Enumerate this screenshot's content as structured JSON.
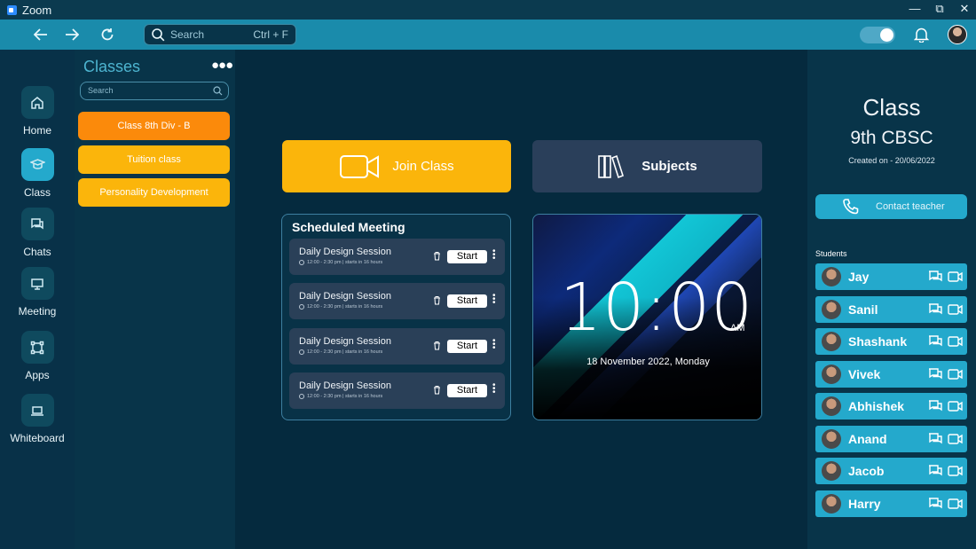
{
  "window": {
    "title": "Zoom"
  },
  "toolbar": {
    "search_placeholder": "Search",
    "search_shortcut": "Ctrl + F"
  },
  "rail": {
    "items": [
      {
        "label": "Home",
        "icon": "home-icon",
        "active": false
      },
      {
        "label": "Class",
        "icon": "graduation-cap-icon",
        "active": true
      },
      {
        "label": "Chats",
        "icon": "chat-icon",
        "active": false
      },
      {
        "label": "Meeting",
        "icon": "presentation-icon",
        "active": false
      },
      {
        "label": "Apps",
        "icon": "apps-icon",
        "active": false
      },
      {
        "label": "Whiteboard",
        "icon": "laptop-icon",
        "active": false
      }
    ]
  },
  "classes": {
    "title": "Classes",
    "search_placeholder": "Search",
    "items": [
      {
        "label": "Class 8th Div - B",
        "color": "#fb8a0b"
      },
      {
        "label": "Tuition class",
        "color": "#fbb50b"
      },
      {
        "label": "Personality Development",
        "color": "#fbb50b"
      }
    ]
  },
  "main": {
    "join_label": "Join Class",
    "subjects_label": "Subjects",
    "scheduled": {
      "title": "Scheduled Meeting",
      "meetings": [
        {
          "title": "Daily Design Session",
          "time": "12:00 - 2:30 pm",
          "starts": "starts in 16 hours",
          "button": "Start"
        },
        {
          "title": "Daily Design Session",
          "time": "12:00 - 2:30 pm",
          "starts": "starts in 16 hours",
          "button": "Start"
        },
        {
          "title": "Daily Design Session",
          "time": "12:00 - 2:30 pm",
          "starts": "starts in 16 hours",
          "button": "Start"
        },
        {
          "title": "Daily Design Session",
          "time": "12:00 - 2:30 pm",
          "starts": "starts in 16 hours",
          "button": "Start"
        }
      ]
    },
    "clock": {
      "time": "10:00",
      "ampm": "AM",
      "date": "18 November 2022, Monday"
    }
  },
  "right": {
    "class_label": "Class",
    "class_name": "9th CBSC",
    "created": "Created on - 20/06/2022",
    "contact_label": "Contact teacher",
    "students_label": "Students",
    "students": [
      "Jay",
      "Sanil",
      "Shashank",
      "Vivek",
      "Abhishek",
      "Anand",
      "Jacob",
      "Harry"
    ]
  },
  "colors": {
    "accent": "#24a9cc",
    "orange": "#fb8a0b",
    "yellow": "#fbb50b",
    "background": "#052a3e"
  }
}
